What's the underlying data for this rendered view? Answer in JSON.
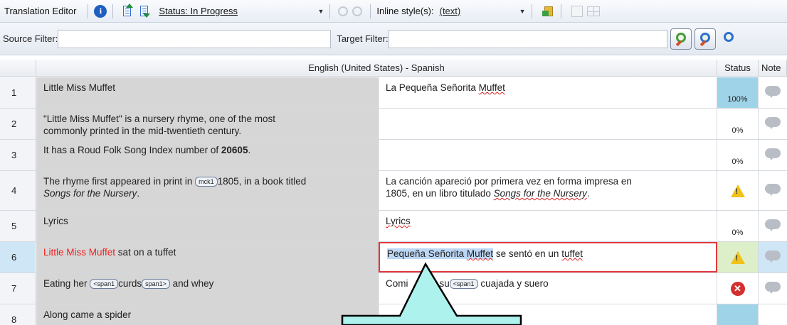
{
  "toolbar": {
    "title": "Translation Editor",
    "status_filter": "Status: In Progress",
    "inline_style_label": "Inline style(s):",
    "inline_style_value": "(text)"
  },
  "filters": {
    "source_label": "Source Filter:",
    "target_label": "Target Filter:"
  },
  "grid": {
    "header": "English (United States) - Spanish",
    "status_col": "Status",
    "notes_col": "Note",
    "rows": [
      {
        "num": "1",
        "source": "Little Miss Muffet",
        "target_a": "La Pequeña Señorita ",
        "target_b": "Muffet",
        "status": "100%"
      },
      {
        "num": "2",
        "source_l1": "\"Little Miss Muffet\" is a nursery rhyme, one of the most",
        "source_l2": "commonly printed in the mid-twentieth century.",
        "status": "0%"
      },
      {
        "num": "3",
        "source_a": "It has a Roud Folk Song Index number of ",
        "source_b": "20605",
        "source_c": ".",
        "status": "0%"
      },
      {
        "num": "4",
        "source_a": "The rhyme first appeared in print in ",
        "source_tag": "mck1",
        "source_b": "1805, in a book titled",
        "source_c": "Songs for the Nursery",
        "source_d": ".",
        "target_a": "La canción apareció por primera vez en forma impresa en",
        "target_b": "1805, en un libro titulado ",
        "target_c": "Songs for the Nursery",
        "target_d": ".",
        "status": "warning"
      },
      {
        "num": "5",
        "source": "Lyrics",
        "target": "Lyrics",
        "status": "0%"
      },
      {
        "num": "6",
        "source_a": "Little Miss Muffet",
        "source_b": " sat on a tuffet",
        "target_a": "Pequeña Señorita ",
        "target_b": "Muffet",
        "target_c": " se sentó en un ",
        "target_d": "tuffet",
        "status": "warning"
      },
      {
        "num": "7",
        "source_a": "Eating her ",
        "tag_open": "<span1",
        "source_b": "curds",
        "tag_close": "span1>",
        "source_c": " and whey",
        "target_a": "Comi",
        "target_b": "su",
        "target_c": " cuajada y suero",
        "status": "error"
      },
      {
        "num": "8",
        "source": "Along came a spider",
        "status": ""
      }
    ]
  }
}
